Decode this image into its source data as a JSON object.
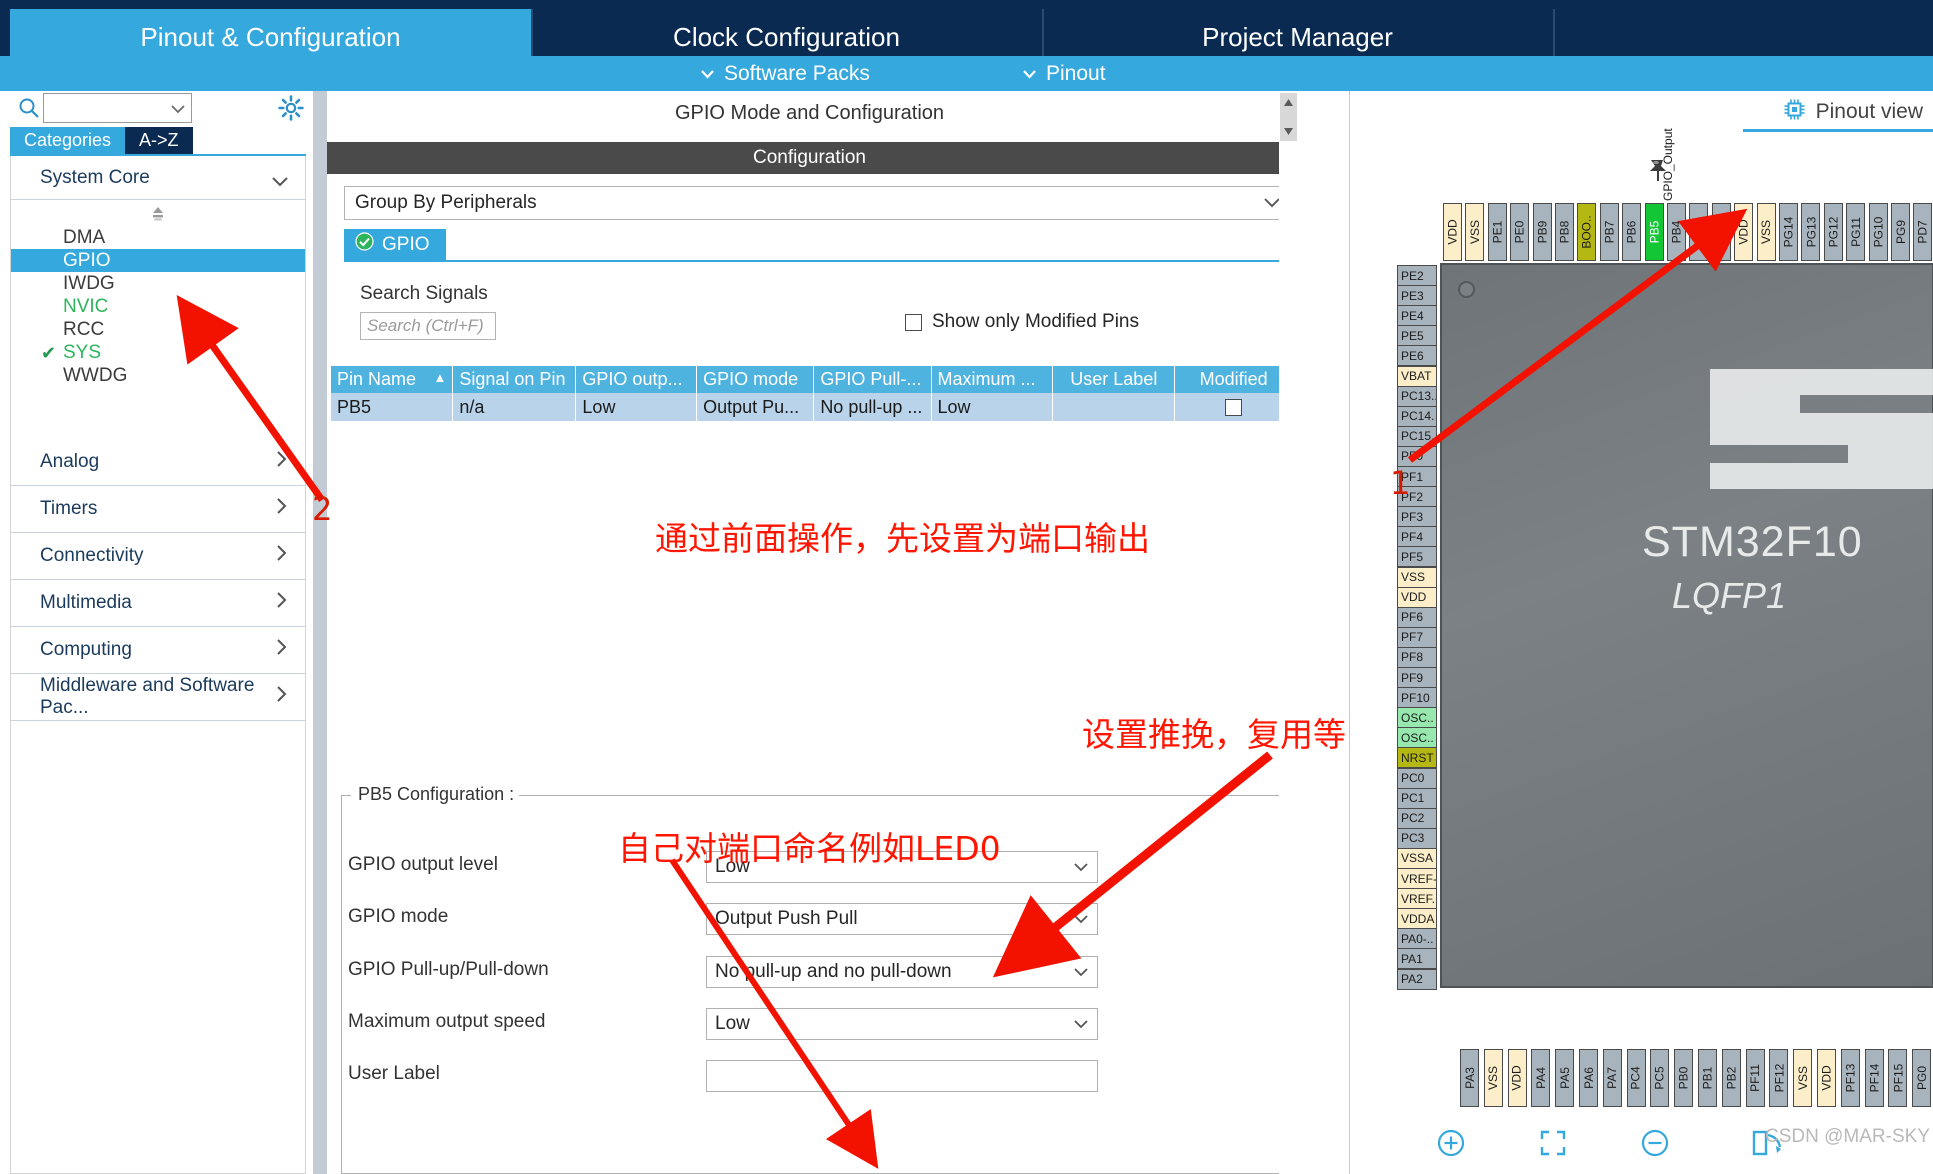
{
  "top_tabs": [
    {
      "label": "Pinout & Configuration",
      "active": true
    },
    {
      "label": "Clock Configuration",
      "active": false
    },
    {
      "label": "Project Manager",
      "active": false
    }
  ],
  "sub_menu": [
    {
      "label": "Software Packs",
      "icon": "chevron-down-icon"
    },
    {
      "label": "Pinout",
      "icon": "chevron-down-icon"
    }
  ],
  "sidebar": {
    "search_value": "",
    "search_icon": "search-icon",
    "gear_icon": "gear-icon",
    "tabs": [
      {
        "label": "Categories",
        "selected": true
      },
      {
        "label": "A->Z",
        "selected": false
      }
    ],
    "category_header": "System Core",
    "peripherals": [
      {
        "label": "DMA",
        "selected": false,
        "configured": false,
        "checked": false
      },
      {
        "label": "GPIO",
        "selected": true,
        "configured": false,
        "checked": false
      },
      {
        "label": "IWDG",
        "selected": false,
        "configured": false,
        "checked": false
      },
      {
        "label": "NVIC",
        "selected": false,
        "configured": true,
        "checked": false
      },
      {
        "label": "RCC",
        "selected": false,
        "configured": false,
        "checked": false
      },
      {
        "label": "SYS",
        "selected": false,
        "configured": true,
        "checked": true
      },
      {
        "label": "WWDG",
        "selected": false,
        "configured": false,
        "checked": false
      }
    ],
    "categories": [
      {
        "label": "Analog"
      },
      {
        "label": "Timers"
      },
      {
        "label": "Connectivity"
      },
      {
        "label": "Multimedia"
      },
      {
        "label": "Computing"
      },
      {
        "label": "Middleware and Software Pac..."
      }
    ]
  },
  "center": {
    "title": "GPIO Mode and Configuration",
    "configuration_band": "Configuration",
    "group_by": "Group By Peripherals",
    "peripheral_tab": "GPIO",
    "peripheral_tab_icon": "check-circle-icon",
    "search_signals_label": "Search Signals",
    "search_placeholder": "Search (Ctrl+F)",
    "show_only_modified_label": "Show only Modified Pins",
    "show_only_modified_checked": false,
    "table": {
      "columns": [
        "Pin Name",
        "Signal on Pin",
        "GPIO outp...",
        "GPIO mode",
        "GPIO Pull-...",
        "Maximum ...",
        "User Label",
        "Modified"
      ],
      "rows": [
        {
          "pin_name": "PB5",
          "signal_on_pin": "n/a",
          "gpio_output": "Low",
          "gpio_mode": "Output Pu...",
          "gpio_pull": "No pull-up ...",
          "maximum": "Low",
          "user_label": "",
          "modified": false
        }
      ]
    },
    "config_group_legend": "PB5 Configuration :",
    "fields": [
      {
        "label": "GPIO output level",
        "value": "Low",
        "type": "select"
      },
      {
        "label": "GPIO mode",
        "value": "Output Push Pull",
        "type": "select"
      },
      {
        "label": "GPIO Pull-up/Pull-down",
        "value": "No pull-up and no pull-down",
        "type": "select"
      },
      {
        "label": "Maximum output speed",
        "value": "Low",
        "type": "select"
      },
      {
        "label": "User Label",
        "value": "",
        "type": "text"
      }
    ]
  },
  "pinout": {
    "view_label": "Pinout view",
    "view_icon": "chip-icon",
    "chip_name": "STM32F10",
    "chip_package": "LQFP1",
    "zoom_icons": [
      {
        "name": "zoom-in-icon"
      },
      {
        "name": "fit-to-screen-icon"
      },
      {
        "name": "zoom-out-icon"
      },
      {
        "name": "rotate-icon"
      }
    ],
    "watermark": "CSDN @MAR-SKY",
    "selected_pin": "PB5",
    "selected_pin_signal": "GPIO_Output",
    "top_pins": [
      {
        "l": "VDD",
        "c": "cream"
      },
      {
        "l": "VSS",
        "c": "cream"
      },
      {
        "l": "PE1",
        "c": "gray"
      },
      {
        "l": "PE0",
        "c": "gray"
      },
      {
        "l": "PB9",
        "c": "gray"
      },
      {
        "l": "PB8",
        "c": "gray"
      },
      {
        "l": "BOO..",
        "c": "olive"
      },
      {
        "l": "PB7",
        "c": "gray"
      },
      {
        "l": "PB6",
        "c": "gray"
      },
      {
        "l": "PB5",
        "c": "green"
      },
      {
        "l": "PB4",
        "c": "gray"
      },
      {
        "l": "PB3",
        "c": "gray"
      },
      {
        "l": "PG15",
        "c": "gray"
      },
      {
        "l": "VDD",
        "c": "cream"
      },
      {
        "l": "VSS",
        "c": "cream"
      },
      {
        "l": "PG14",
        "c": "gray"
      },
      {
        "l": "PG13",
        "c": "gray"
      },
      {
        "l": "PG12",
        "c": "gray"
      },
      {
        "l": "PG11",
        "c": "gray"
      },
      {
        "l": "PG10",
        "c": "gray"
      },
      {
        "l": "PG9",
        "c": "gray"
      },
      {
        "l": "PD7",
        "c": "gray"
      }
    ],
    "left_pins": [
      {
        "l": "PE2",
        "c": "gray"
      },
      {
        "l": "PE3",
        "c": "gray"
      },
      {
        "l": "PE4",
        "c": "gray"
      },
      {
        "l": "PE5",
        "c": "gray"
      },
      {
        "l": "PE6",
        "c": "gray"
      },
      {
        "l": "VBAT",
        "c": "cream"
      },
      {
        "l": "PC13..",
        "c": "gray"
      },
      {
        "l": "PC14.",
        "c": "gray"
      },
      {
        "l": "PC15..",
        "c": "gray"
      },
      {
        "l": "PF0",
        "c": "gray"
      },
      {
        "l": "PF1",
        "c": "gray"
      },
      {
        "l": "PF2",
        "c": "gray"
      },
      {
        "l": "PF3",
        "c": "gray"
      },
      {
        "l": "PF4",
        "c": "gray"
      },
      {
        "l": "PF5",
        "c": "gray"
      },
      {
        "l": "VSS",
        "c": "cream"
      },
      {
        "l": "VDD",
        "c": "cream"
      },
      {
        "l": "PF6",
        "c": "gray"
      },
      {
        "l": "PF7",
        "c": "gray"
      },
      {
        "l": "PF8",
        "c": "gray"
      },
      {
        "l": "PF9",
        "c": "gray"
      },
      {
        "l": "PF10",
        "c": "gray"
      },
      {
        "l": "OSC..",
        "c": "mint"
      },
      {
        "l": "OSC..",
        "c": "mint"
      },
      {
        "l": "NRST",
        "c": "olive"
      },
      {
        "l": "PC0",
        "c": "gray"
      },
      {
        "l": "PC1",
        "c": "gray"
      },
      {
        "l": "PC2",
        "c": "gray"
      },
      {
        "l": "PC3",
        "c": "gray"
      },
      {
        "l": "VSSA",
        "c": "cream"
      },
      {
        "l": "VREF-",
        "c": "cream"
      },
      {
        "l": "VREF..",
        "c": "cream"
      },
      {
        "l": "VDDA",
        "c": "cream"
      },
      {
        "l": "PA0-..",
        "c": "gray"
      },
      {
        "l": "PA1",
        "c": "gray"
      },
      {
        "l": "PA2",
        "c": "gray"
      }
    ],
    "bottom_pins": [
      {
        "l": "PA3",
        "c": "gray"
      },
      {
        "l": "VSS",
        "c": "cream"
      },
      {
        "l": "VDD",
        "c": "cream"
      },
      {
        "l": "PA4",
        "c": "gray"
      },
      {
        "l": "PA5",
        "c": "gray"
      },
      {
        "l": "PA6",
        "c": "gray"
      },
      {
        "l": "PA7",
        "c": "gray"
      },
      {
        "l": "PC4",
        "c": "gray"
      },
      {
        "l": "PC5",
        "c": "gray"
      },
      {
        "l": "PB0",
        "c": "gray"
      },
      {
        "l": "PB1",
        "c": "gray"
      },
      {
        "l": "PB2",
        "c": "gray"
      },
      {
        "l": "PF11",
        "c": "gray"
      },
      {
        "l": "PF12",
        "c": "gray"
      },
      {
        "l": "VSS",
        "c": "cream"
      },
      {
        "l": "VDD",
        "c": "cream"
      },
      {
        "l": "PF13",
        "c": "gray"
      },
      {
        "l": "PF14",
        "c": "gray"
      },
      {
        "l": "PF15",
        "c": "gray"
      },
      {
        "l": "PG0",
        "c": "gray"
      }
    ]
  },
  "annotations": [
    {
      "id": "a1",
      "text": "1",
      "kind": "number"
    },
    {
      "id": "a2",
      "text": "2",
      "kind": "number"
    },
    {
      "id": "a3",
      "text": "通过前面操作，先设置为端口输出",
      "kind": "note"
    },
    {
      "id": "a4",
      "text": "设置推挽，复用等",
      "kind": "note"
    },
    {
      "id": "a5",
      "text": "自己对端口命名例如LED0",
      "kind": "note"
    }
  ],
  "colors": {
    "accent_blue": "#35a8dd",
    "dark_navy": "#0a2a52",
    "table_header": "#4fb3e0",
    "table_row": "#b9d4ea",
    "annotation_red": "#ff1500",
    "pin_selected_green": "#12c636"
  }
}
